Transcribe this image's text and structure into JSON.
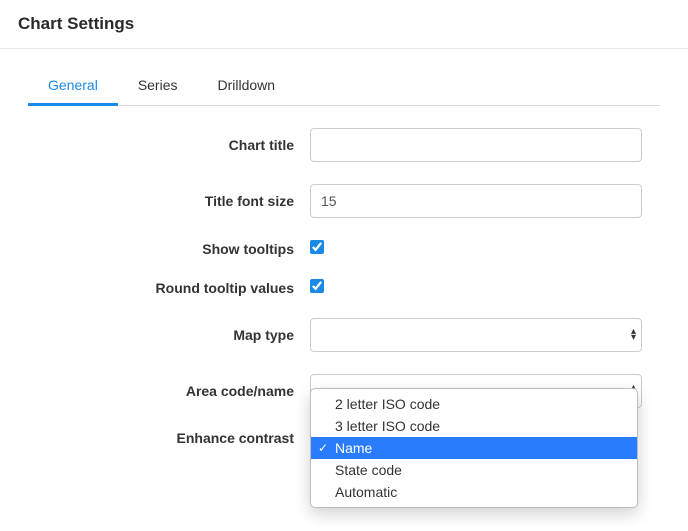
{
  "header": {
    "title": "Chart Settings"
  },
  "tabs": [
    {
      "label": "General",
      "active": true
    },
    {
      "label": "Series",
      "active": false
    },
    {
      "label": "Drilldown",
      "active": false
    }
  ],
  "form": {
    "chart_title": {
      "label": "Chart title",
      "value": ""
    },
    "title_font_size": {
      "label": "Title font size",
      "value": "15"
    },
    "show_tooltips": {
      "label": "Show tooltips",
      "checked": true
    },
    "round_tooltip_values": {
      "label": "Round tooltip values",
      "checked": true
    },
    "map_type": {
      "label": "Map type",
      "value": ""
    },
    "area_code_name": {
      "label": "Area code/name",
      "options": [
        {
          "label": "2 letter ISO code",
          "selected": false
        },
        {
          "label": "3 letter ISO code",
          "selected": false
        },
        {
          "label": "Name",
          "selected": true
        },
        {
          "label": "State code",
          "selected": false
        },
        {
          "label": "Automatic",
          "selected": false
        }
      ]
    },
    "enhance_contrast": {
      "label": "Enhance contrast"
    }
  }
}
